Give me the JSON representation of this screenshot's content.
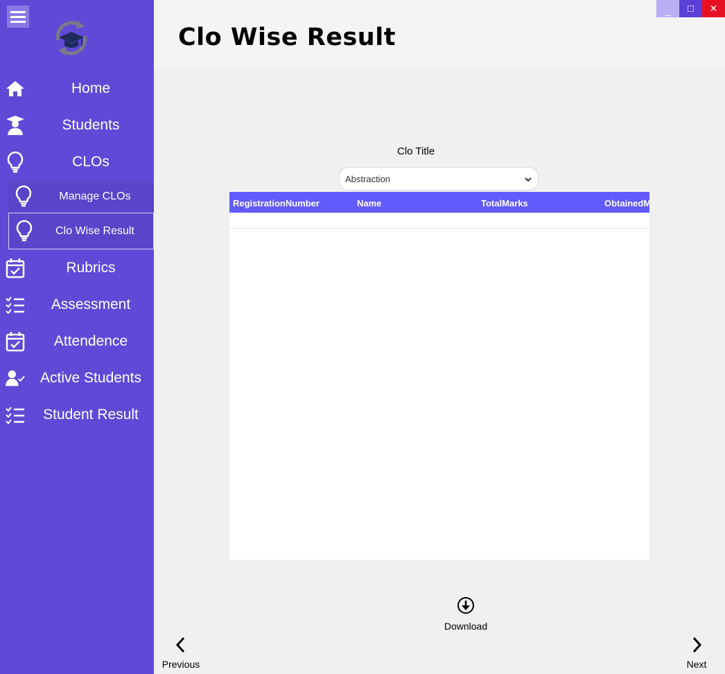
{
  "sidebar": {
    "menu_icon": "hamburger-icon",
    "logo_icon": "graduation-cap-logo",
    "items": [
      {
        "label": "Home",
        "icon": "home-icon"
      },
      {
        "label": "Students",
        "icon": "student-icon"
      },
      {
        "label": "CLOs",
        "icon": "lightbulb-icon"
      },
      {
        "label": "Manage CLOs",
        "icon": "lightbulb-icon"
      },
      {
        "label": "Clo Wise Result",
        "icon": "lightbulb-icon"
      },
      {
        "label": "Rubrics",
        "icon": "calendar-check-icon"
      },
      {
        "label": "Assessment",
        "icon": "checklist-icon"
      },
      {
        "label": "Attendence",
        "icon": "calendar-check-icon"
      },
      {
        "label": "Active Students",
        "icon": "user-check-icon"
      },
      {
        "label": "Student Result",
        "icon": "checklist-icon"
      }
    ]
  },
  "header": {
    "title": "Clo Wise Result"
  },
  "window": {
    "minimize": "_",
    "maximize": "□",
    "close": "✕"
  },
  "filter": {
    "label": "Clo Title",
    "selected": "Abstraction"
  },
  "grid": {
    "columns": [
      "RegistrationNumber",
      "Name",
      "TotalMarks",
      "ObtainedM"
    ],
    "rows": []
  },
  "actions": {
    "download": "Download",
    "previous": "Previous",
    "next": "Next"
  },
  "colors": {
    "sidebar": "#6049d6",
    "grid_header": "#625afb",
    "close": "#e81123"
  }
}
